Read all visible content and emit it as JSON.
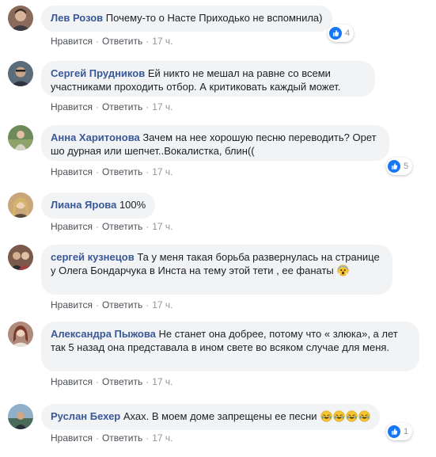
{
  "actions": {
    "like_label": "Нравится",
    "reply_label": "Ответить",
    "separator": "·"
  },
  "comments": [
    {
      "author": "Лев Розов",
      "text": "Почему-то о Насте Приходько не вспомнила)",
      "time": "17 ч.",
      "reaction_count": "4",
      "avatar_color": "#8a6a5a"
    },
    {
      "author": "Сергей Прудников",
      "text": "Ей никто не мешал на равне со всеми участниками проходить отбор. А критиковать каждый может.",
      "time": "17 ч.",
      "avatar_color": "#5a6b7a"
    },
    {
      "author": "Анна Харитонова",
      "text": "Зачем на нее хорошую песню переводить? Орет шо дурная или шепчет..Вокалистка, блин((",
      "time": "17 ч.",
      "reaction_count": "5",
      "avatar_color": "#6f8a5a"
    },
    {
      "author": "Лиана Ярова",
      "text": "100%",
      "time": "17 ч.",
      "avatar_color": "#c9a77a"
    },
    {
      "author": "сергей кузнецов",
      "text": "Та у меня такая борьба развернулась на странице у Олега Бондарчука в Инста на тему этой тети , ее фанаты",
      "time": "17 ч.",
      "avatar_color": "#7a5a4a",
      "emoji": "scared-face-emoji"
    },
    {
      "author": "Александра Пыжова",
      "text": "Не станет она добрее, потому что « злюка», а лет так 5 назад она представала в ином свете во всяком случае для меня.",
      "time": "17 ч.",
      "avatar_color": "#b08a7a"
    },
    {
      "author": "Руслан Бехер",
      "text": "Ахах. В моем доме запрещены ее песни",
      "time": "17 ч.",
      "reaction_count": "1",
      "avatar_color": "#4a5a6a",
      "emoji": "rolling-laughing-emoji x4"
    }
  ],
  "colors": {
    "author": "#385898",
    "bubble": "#f2f3f5",
    "like_blue": "#1877f2",
    "meta_gray": "#90949c"
  }
}
